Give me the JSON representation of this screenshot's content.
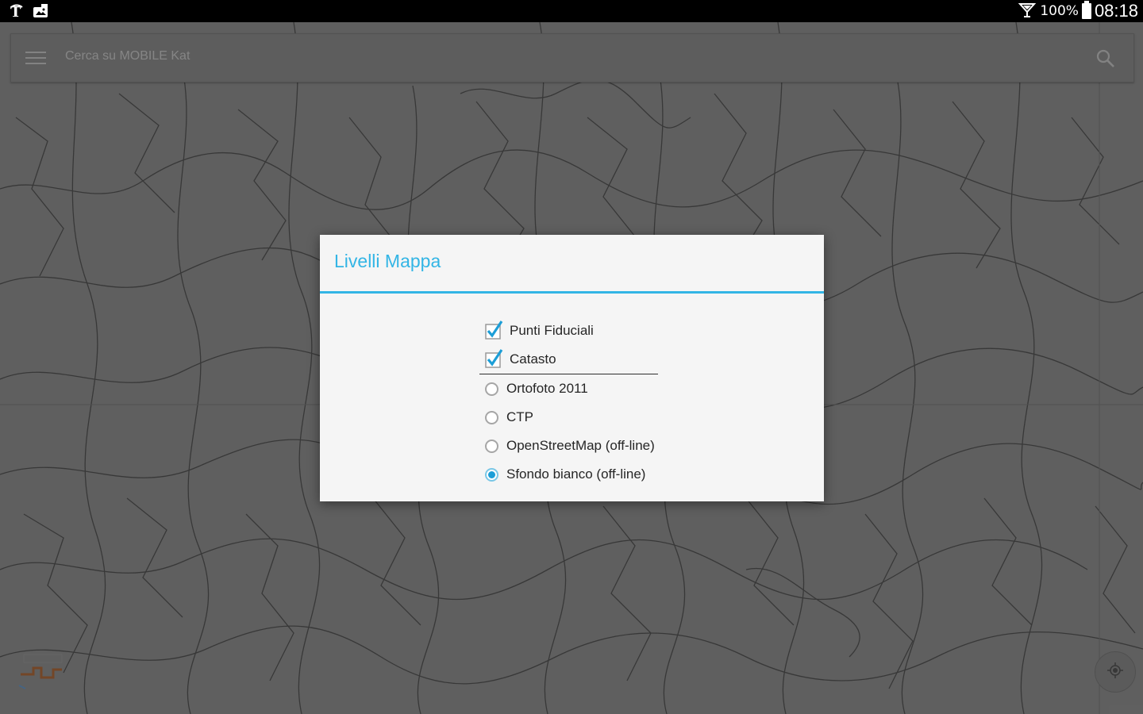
{
  "status_bar": {
    "battery_percent": "100%",
    "time": "08:18",
    "left_icons": [
      "nyt-icon",
      "gallery-icon"
    ],
    "right_icons": [
      "signal-icon",
      "battery-icon"
    ]
  },
  "search": {
    "placeholder": "Cerca su MOBILE Kat",
    "menu_icon": "hamburger-menu-icon",
    "search_icon": "search-icon"
  },
  "dialog": {
    "title": "Livelli Mappa",
    "accent_color": "#33b5e5",
    "overlays": [
      {
        "label": "Punti Fiduciali",
        "checked": true
      },
      {
        "label": "Catasto",
        "checked": true
      }
    ],
    "base_layers": [
      {
        "label": "Ortofoto 2011",
        "selected": false
      },
      {
        "label": "CTP",
        "selected": false
      },
      {
        "label": "OpenStreetMap (off-line)",
        "selected": false
      },
      {
        "label": "Sfondo bianco (off-line)",
        "selected": true
      }
    ]
  },
  "map": {
    "locate_icon": "my-location-icon",
    "logo_icon": "map-logo-icon"
  }
}
